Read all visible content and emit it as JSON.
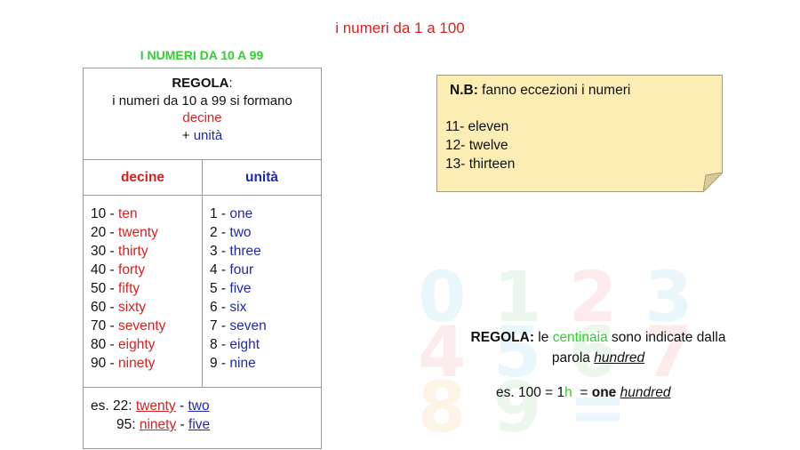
{
  "title": "i numeri da 1 a 100",
  "subtitle": "I NUMERI DA 10 A 99",
  "rule": {
    "label": "REGOLA",
    "colon": ":",
    "line1": "i numeri da 10 a 99 si formano",
    "word_tens": "decine",
    "plus": "+ ",
    "word_units": "unità"
  },
  "headers": {
    "tens": "decine",
    "units": "unità"
  },
  "tens": [
    {
      "num": "10 - ",
      "word": "ten"
    },
    {
      "num": "20 - ",
      "word": "twenty"
    },
    {
      "num": "30 - ",
      "word": "thirty"
    },
    {
      "num": "40 - ",
      "word": "forty"
    },
    {
      "num": "50 - ",
      "word": "fifty"
    },
    {
      "num": "60 - ",
      "word": "sixty"
    },
    {
      "num": "70 - ",
      "word": "seventy"
    },
    {
      "num": "80 - ",
      "word": "eighty"
    },
    {
      "num": "90 - ",
      "word": "ninety"
    }
  ],
  "units": [
    {
      "num": "1 - ",
      "word": "one"
    },
    {
      "num": "2 - ",
      "word": "two"
    },
    {
      "num": "3 - ",
      "word": "three"
    },
    {
      "num": "4 - ",
      "word": "four"
    },
    {
      "num": "5 - ",
      "word": "five"
    },
    {
      "num": "6 - ",
      "word": "six"
    },
    {
      "num": "7 - ",
      "word": "seven"
    },
    {
      "num": "8 - ",
      "word": "eight"
    },
    {
      "num": "9 - ",
      "word": "nine"
    }
  ],
  "example": {
    "prefix": "es. 22: ",
    "e1_tens": "twenty",
    "sep": " - ",
    "e1_units": "two",
    "prefix2": "95: ",
    "e2_tens": "ninety",
    "e2_units": "five"
  },
  "note": {
    "label": "N.B:",
    "text": " fanno eccezioni i numeri",
    "items": [
      "11- eleven",
      "12- twelve",
      "13- thirteen"
    ]
  },
  "hundred_rule": {
    "label": "REGOLA:",
    "t1": " le ",
    "word_green": "centinaia",
    "t2": " sono indicate dalla",
    "t3": "parola ",
    "word_hundred": "hundred"
  },
  "hundred_example": {
    "prefix": "es. 100 = 1",
    "h": "h",
    "eq": "  = ",
    "one": "one",
    "space": " ",
    "hundred": "hundred"
  },
  "colors": {
    "red": "#d91f1f",
    "blue": "#1f2aaa",
    "green": "#33cc33",
    "note_bg": "#fbedb3"
  },
  "background_digits": [
    "0",
    "1",
    "2",
    "3",
    "4",
    "5",
    "6",
    "7",
    "8",
    "9",
    "="
  ]
}
